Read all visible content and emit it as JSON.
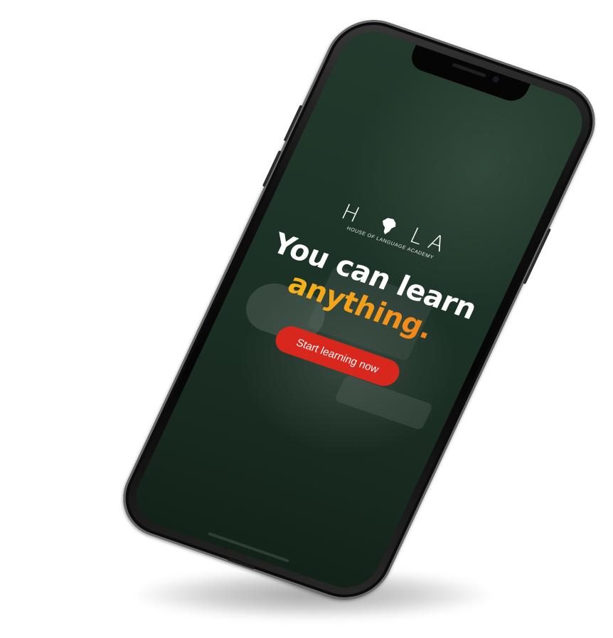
{
  "app": {
    "logo_word_left": "H",
    "logo_word_right": "LA",
    "logo_icon": "africa-map-icon",
    "logo_subtitle": "HOUSE OF LANGUAGE ACADEMY"
  },
  "hero": {
    "headline_line1": "You can learn",
    "headline_accent": "anything.",
    "accent_gradient": [
      "#f6c21a",
      "#f39a1a",
      "#ee6f1c"
    ],
    "cta_label": "Start learning now",
    "cta_color": "#d8281d"
  },
  "device": {
    "frame_color": "#0c0c0c",
    "screen_overlay_color": "#1d3327"
  }
}
